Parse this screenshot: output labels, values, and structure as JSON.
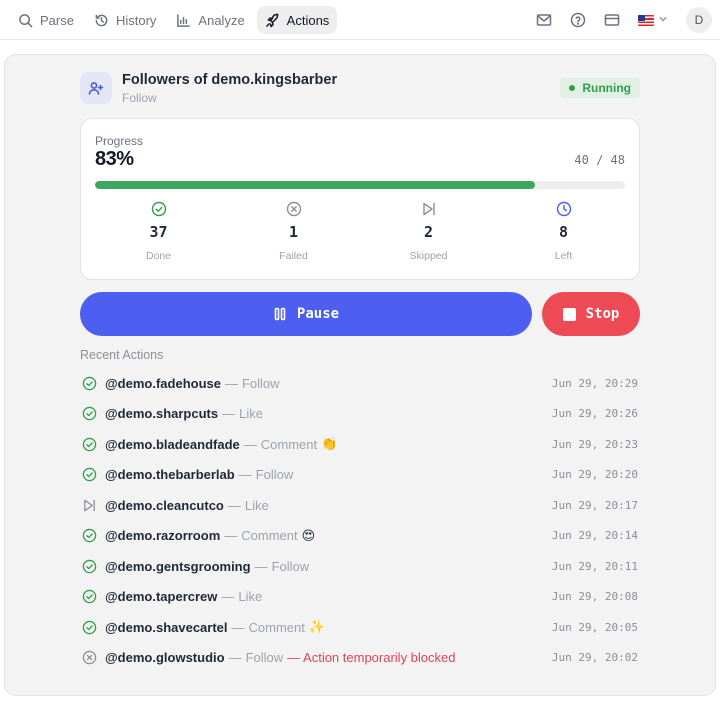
{
  "nav": {
    "items": [
      {
        "label": "Parse",
        "icon": "search-icon"
      },
      {
        "label": "History",
        "icon": "history-icon"
      },
      {
        "label": "Analyze",
        "icon": "bar-chart-icon"
      },
      {
        "label": "Actions",
        "icon": "rocket-icon",
        "active": true
      }
    ],
    "avatar_initial": "D",
    "language_flag": "us-flag-icon"
  },
  "task": {
    "title": "Followers of demo.kingsbarber",
    "subtitle": "Follow",
    "status": "Running"
  },
  "progress": {
    "label": "Progress",
    "percent_text": "83%",
    "count_text": "40 / 48",
    "fraction": 0.83
  },
  "stats": [
    {
      "value": "37",
      "label": "Done",
      "icon": "check-circle-icon",
      "color": "#2f9e4d"
    },
    {
      "value": "1",
      "label": "Failed",
      "icon": "x-circle-icon",
      "color": "#8a8f99"
    },
    {
      "value": "2",
      "label": "Skipped",
      "icon": "skip-icon",
      "color": "#8a8f99"
    },
    {
      "value": "8",
      "label": "Left",
      "icon": "clock-icon",
      "color": "#4c5ff0"
    }
  ],
  "buttons": {
    "pause": "Pause",
    "stop": "Stop"
  },
  "recent": {
    "title": "Recent Actions",
    "items": [
      {
        "user": "@demo.fadehouse",
        "type": "Follow",
        "emoji": "",
        "error": "",
        "time": "Jun 29, 20:29",
        "status": "done"
      },
      {
        "user": "@demo.sharpcuts",
        "type": "Like",
        "emoji": "",
        "error": "",
        "time": "Jun 29, 20:26",
        "status": "done"
      },
      {
        "user": "@demo.bladeandfade",
        "type": "Comment",
        "emoji": "👏",
        "error": "",
        "time": "Jun 29, 20:23",
        "status": "done"
      },
      {
        "user": "@demo.thebarberlab",
        "type": "Follow",
        "emoji": "",
        "error": "",
        "time": "Jun 29, 20:20",
        "status": "done"
      },
      {
        "user": "@demo.cleancutco",
        "type": "Like",
        "emoji": "",
        "error": "",
        "time": "Jun 29, 20:17",
        "status": "skipped"
      },
      {
        "user": "@demo.razorroom",
        "type": "Comment",
        "emoji": "😍",
        "error": "",
        "time": "Jun 29, 20:14",
        "status": "done"
      },
      {
        "user": "@demo.gentsgrooming",
        "type": "Follow",
        "emoji": "",
        "error": "",
        "time": "Jun 29, 20:11",
        "status": "done"
      },
      {
        "user": "@demo.tapercrew",
        "type": "Like",
        "emoji": "",
        "error": "",
        "time": "Jun 29, 20:08",
        "status": "done"
      },
      {
        "user": "@demo.shavecartel",
        "type": "Comment",
        "emoji": "✨",
        "error": "",
        "time": "Jun 29, 20:05",
        "status": "done"
      },
      {
        "user": "@demo.glowstudio",
        "type": "Follow",
        "emoji": "",
        "error": "— Action temporarily blocked",
        "time": "Jun 29, 20:02",
        "status": "failed"
      }
    ]
  },
  "colors": {
    "accent": "#4c5ff0",
    "success": "#2f9e4d",
    "danger": "#ee4a55",
    "progress_fill": "#3da760"
  }
}
